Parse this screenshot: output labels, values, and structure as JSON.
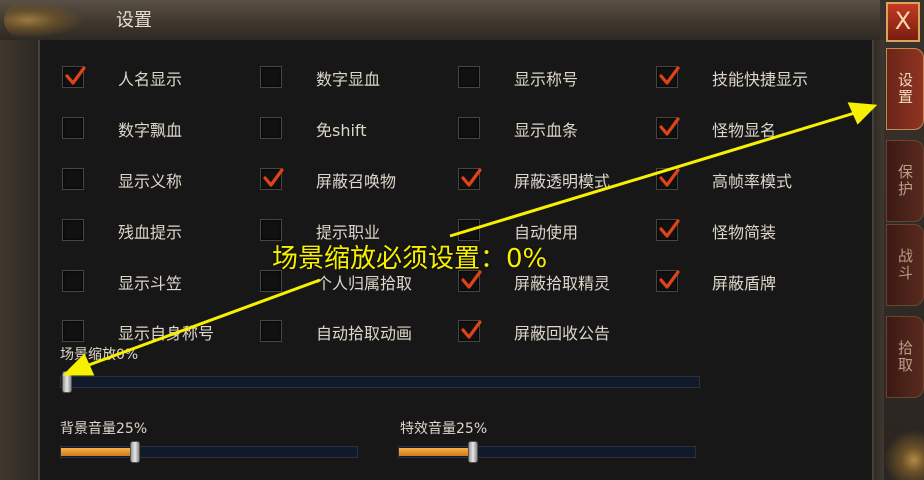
{
  "window": {
    "title": "设置",
    "close_glyph": "X"
  },
  "side_tabs": [
    {
      "label": "设置",
      "active": true
    },
    {
      "label": "保护",
      "active": false
    },
    {
      "label": "战斗",
      "active": false
    },
    {
      "label": "拾取",
      "active": false
    }
  ],
  "options": [
    {
      "label": "人名显示",
      "checked": true
    },
    {
      "label": "数字显血",
      "checked": false
    },
    {
      "label": "显示称号",
      "checked": false
    },
    {
      "label": "技能快捷显示",
      "checked": true
    },
    {
      "label": "数字飘血",
      "checked": false
    },
    {
      "label": "免shift",
      "checked": false
    },
    {
      "label": "显示血条",
      "checked": false
    },
    {
      "label": "怪物显名",
      "checked": true
    },
    {
      "label": "显示义称",
      "checked": false
    },
    {
      "label": "屏蔽召唤物",
      "checked": true
    },
    {
      "label": "屏蔽透明模式",
      "checked": true
    },
    {
      "label": "高帧率模式",
      "checked": true
    },
    {
      "label": "残血提示",
      "checked": false
    },
    {
      "label": "提示职业",
      "checked": false
    },
    {
      "label": "自动使用",
      "checked": false
    },
    {
      "label": "怪物简装",
      "checked": true
    },
    {
      "label": "显示斗笠",
      "checked": false
    },
    {
      "label": "个人归属拾取",
      "checked": false
    },
    {
      "label": "屏蔽拾取精灵",
      "checked": true
    },
    {
      "label": "屏蔽盾牌",
      "checked": true
    },
    {
      "label": "显示自身称号",
      "checked": false
    },
    {
      "label": "自动拾取动画",
      "checked": false
    },
    {
      "label": "屏蔽回收公告",
      "checked": true
    }
  ],
  "sliders": {
    "scene_zoom": {
      "label": "场景缩放0%",
      "value_pct": 0
    },
    "bg_volume": {
      "label": "背景音量25%",
      "value_pct": 25
    },
    "fx_volume": {
      "label": "特效音量25%",
      "value_pct": 25
    }
  },
  "annotation": {
    "text": "场景缩放必须设置：0%",
    "color": "#f7f000"
  },
  "colors": {
    "check": "#e0431a",
    "slider_fill": "#e8941f",
    "active_tab": "#8f3422"
  }
}
